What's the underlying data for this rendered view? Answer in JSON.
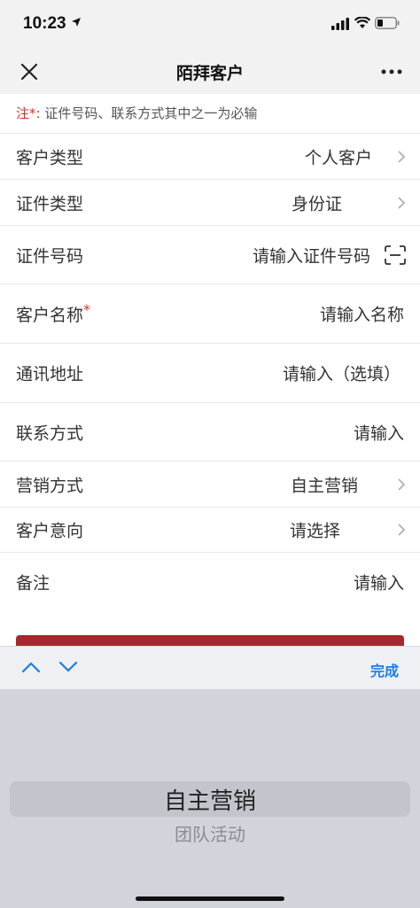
{
  "status_bar": {
    "time": "10:23"
  },
  "nav": {
    "title": "陌拜客户"
  },
  "note": {
    "prefix": "注*:",
    "text": "证件号码、联系方式其中之一为必输"
  },
  "form": {
    "customer_type": {
      "label": "客户类型",
      "value": "个人客户"
    },
    "id_type": {
      "label": "证件类型",
      "value": "身份证"
    },
    "id_number": {
      "label": "证件号码",
      "placeholder": "请输入证件号码"
    },
    "customer_name": {
      "label": "客户名称",
      "required_mark": "*",
      "placeholder": "请输入名称"
    },
    "address": {
      "label": "通讯地址",
      "placeholder": "请输入（选填）"
    },
    "contact": {
      "label": "联系方式",
      "placeholder": "请输入"
    },
    "marketing_method": {
      "label": "营销方式",
      "value": "自主营销"
    },
    "customer_intent": {
      "label": "客户意向",
      "placeholder": "请选择"
    },
    "remarks": {
      "label": "备注",
      "placeholder": "请输入"
    }
  },
  "toolbar": {
    "done_label": "完成"
  },
  "picker": {
    "selected": "自主营销",
    "next": "团队活动"
  },
  "colors": {
    "accent_red": "#a8262d",
    "required_red": "#d0342c",
    "done_blue": "#1a7cf0"
  }
}
